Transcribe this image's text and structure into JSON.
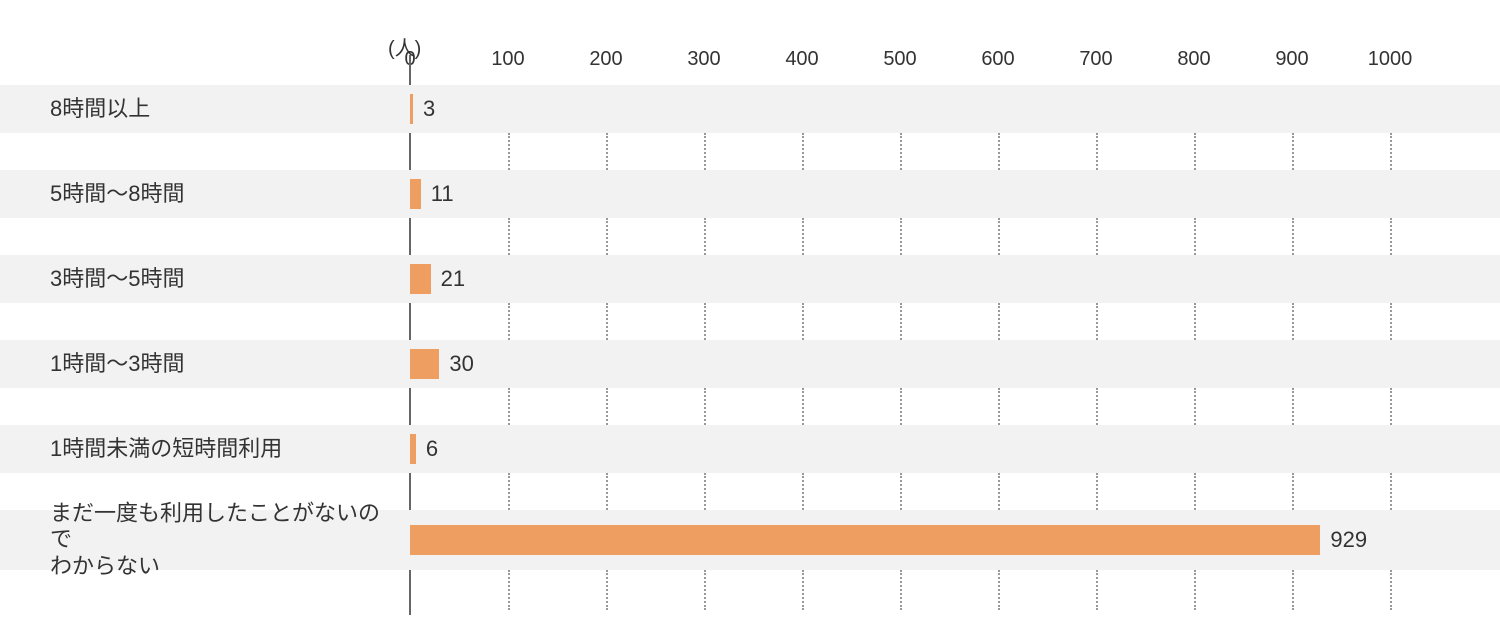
{
  "chart_data": {
    "type": "bar",
    "orientation": "horizontal",
    "unit_label": "(人)",
    "categories": [
      "8時間以上",
      "5時間～8時間",
      "3時間～5時間",
      "1時間～3時間",
      "1時間未満の短時間利用",
      "まだ一度も利用したことがないので\nわからない"
    ],
    "values": [
      3,
      11,
      21,
      30,
      6,
      929
    ],
    "xticks": [
      0,
      100,
      200,
      300,
      400,
      500,
      600,
      700,
      800,
      900,
      1000
    ],
    "xlim": [
      0,
      1000
    ],
    "bar_color": "#ed9e60",
    "row_bg": "#f2f2f2",
    "grid_color": "#999999"
  }
}
